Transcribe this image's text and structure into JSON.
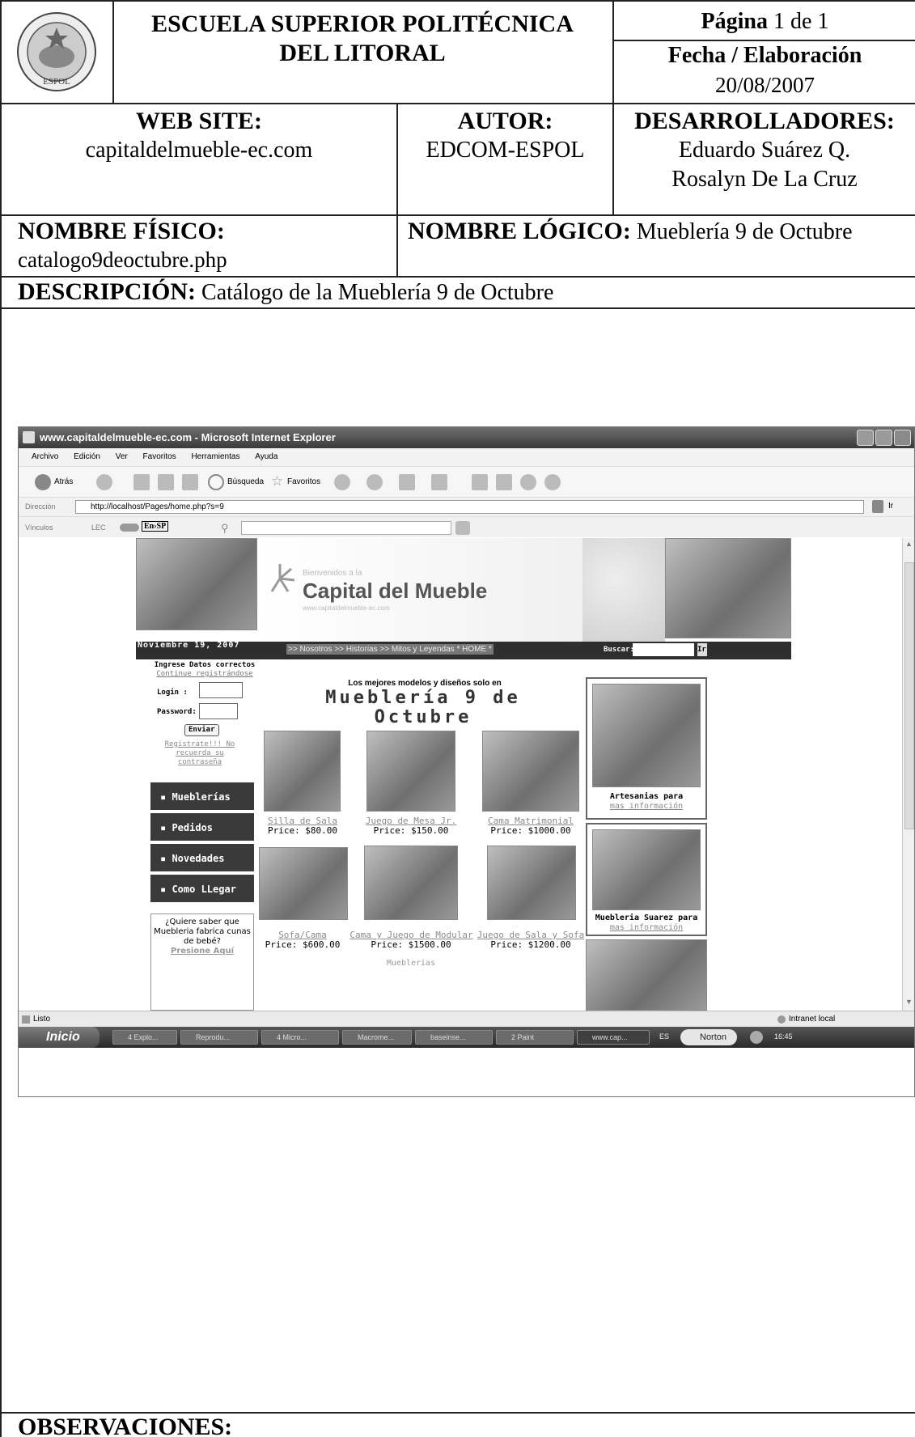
{
  "header": {
    "institution_line1": "ESCUELA SUPERIOR POLITÉCNICA",
    "institution_line2": "DEL LITORAL",
    "page_label": "Página",
    "page_value": "1 de 1",
    "date_label": "Fecha / Elaboración",
    "date_value": "20/08/2007",
    "logo_text": "ESPOL"
  },
  "info": {
    "website_label": "WEB SITE:",
    "website_value": "capitaldelmueble-ec.com",
    "author_label": "AUTOR:",
    "author_value": "EDCOM-ESPOL",
    "developers_label": "DESARROLLADORES:",
    "developers": [
      "Eduardo Suárez Q.",
      "Rosalyn De La Cruz"
    ],
    "physical_label": "NOMBRE FÍSICO:",
    "physical_value": "catalogo9deoctubre.php",
    "logical_label": "NOMBRE LÓGICO:",
    "logical_value": "Mueblería 9 de Octubre",
    "description_label": "DESCRIPCIÓN:",
    "description_value": "Catálogo de la Mueblería 9 de Octubre",
    "observations_label": "OBSERVACIONES:"
  },
  "browser": {
    "title": "www.capitaldelmueble-ec.com - Microsoft Internet Explorer",
    "menu": [
      "Archivo",
      "Edición",
      "Ver",
      "Favoritos",
      "Herramientas",
      "Ayuda"
    ],
    "back_label": "Atrás",
    "search_label": "Búsqueda",
    "favorites_label": "Favoritos",
    "address_label": "Dirección",
    "address_value": "http://localhost/Pages/home.php?s=9",
    "go_label": "Ir",
    "links_label": "Vínculos",
    "lec_label": "LEC",
    "translate_label": "En›SP",
    "status_text": "Listo",
    "zone_text": "Intranet local"
  },
  "taskbar": {
    "start_label": "Inicio",
    "tasks": [
      "4 Explo...",
      "Reprodu...",
      "4 Micro...",
      "Macrome...",
      "baseinse...",
      "2 Paint",
      "www.cap..."
    ],
    "lang": "ES",
    "norton": "Norton",
    "clock": "16:45"
  },
  "site": {
    "welcome": "Bienvenidos a la",
    "brand": "Capital del Mueble",
    "brand_url": "www.capitaldelmueble-ec.com",
    "date": "Noviembre 19, 2007",
    "nav": ">> Nosotros >> Historias >> Mitos y Leyendas * HOME *",
    "search_label": "Buscar:",
    "search_go": "Ir",
    "login_title": "Ingrese Datos correctos",
    "login_sub": "Continue registrándose",
    "login_label": "Login :",
    "password_label": "Password:",
    "send_label": "Enviar",
    "register_link": "Registrate!!! No recuerda su contraseña",
    "side_menu": [
      "Mueblerías",
      "Pedidos",
      "Novedades",
      "Como LLegar"
    ],
    "promo_text": "¿Quiere saber que Muebleria fabrica cunas de bebé?",
    "promo_link": "Presione Aquí",
    "headline_small": "Los mejores modelos y diseños solo en",
    "headline_big": "Mueblería 9 de Octubre",
    "products": [
      {
        "name": "Silla de Sala",
        "price": "Price: $80.00"
      },
      {
        "name": "Juego de Mesa Jr.",
        "price": "Price: $150.00"
      },
      {
        "name": "Cama Matrimonial",
        "price": "Price: $1000.00"
      },
      {
        "name": "Sofa/Cama",
        "price": "Price: $600.00"
      },
      {
        "name": "Cama y Juego de Modular",
        "price": "Price: $1500.00"
      },
      {
        "name": "Juego de Sala y Sofa",
        "price": "Price: $1200.00"
      }
    ],
    "footer_partial": "Mueblerias",
    "right_ads": [
      {
        "title": "Artesanias para",
        "link": "mas información"
      },
      {
        "title": "Muebleria Suarez para",
        "link": "mas información"
      }
    ]
  }
}
